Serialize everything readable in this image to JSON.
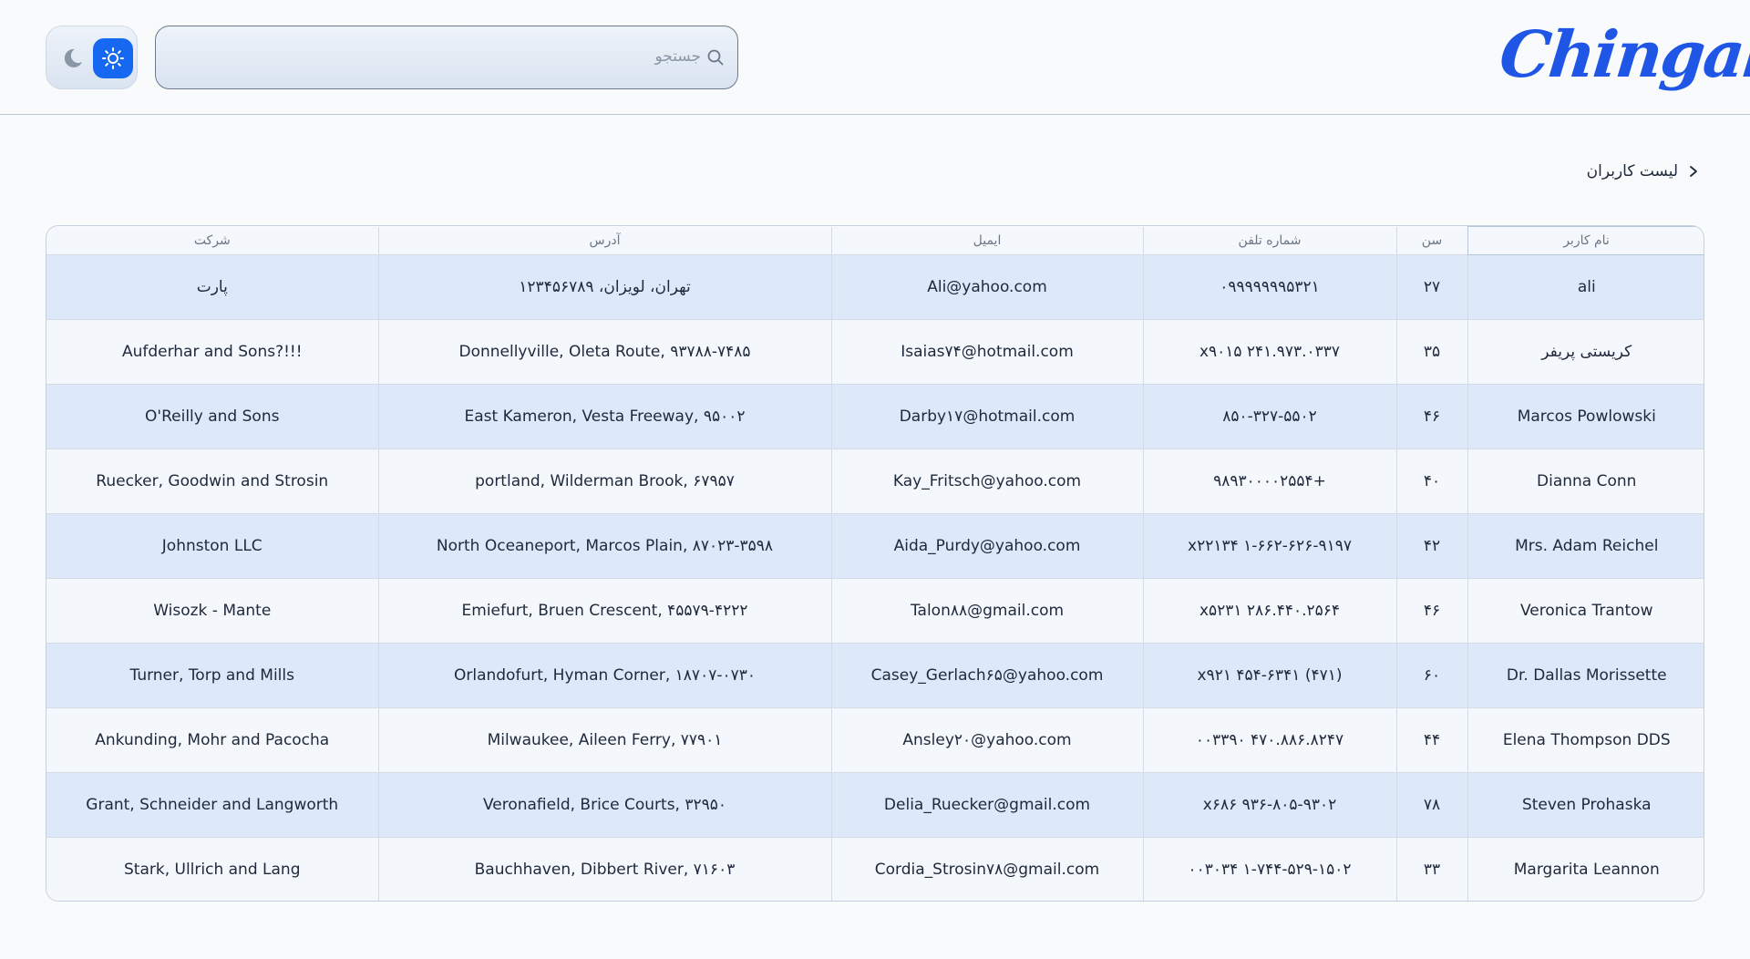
{
  "header": {
    "logo_text": "Chingal",
    "search_placeholder": "جستجو"
  },
  "theme": {
    "light_icon": "sun-icon",
    "dark_icon": "moon-icon",
    "active": "light",
    "accent": "#1668f0"
  },
  "breadcrumb": {
    "label": "لیست کاربران"
  },
  "table": {
    "columns": [
      "نام کاربر",
      "سن",
      "شماره تلفن",
      "ایمیل",
      "آدرس",
      "شرکت"
    ],
    "rows": [
      [
        "ali",
        "۲۷",
        "۰۹۹۹۹۹۹۹۵۳۲۱",
        "Ali@yahoo.com",
        "تهران، لویزان، ۱۲۳۴۵۶۷۸۹",
        "پارت"
      ],
      [
        "کریستی پریفر",
        "۳۵",
        "x۹۰۱۵ ۲۴۱.۹۷۳.۰۳۳۷",
        "Isaias۷۴@hotmail.com",
        "Donnellyville, Oleta Route, ۹۳۷۸۸-۷۴۸۵",
        "Aufderhar and Sons?!!!"
      ],
      [
        "Marcos Powlowski",
        "۴۶",
        "۸۵۰-۳۲۷-۵۵۰۲",
        "Darby۱۷@hotmail.com",
        "East Kameron, Vesta Freeway, ۹۵۰۰۲",
        "O'Reilly and Sons"
      ],
      [
        "Dianna Conn",
        "۴۰",
        "۹۸۹۳۰۰۰۰۲۵۵۴+",
        "Kay_Fritsch@yahoo.com",
        "portland, Wilderman Brook, ۶۷۹۵۷",
        "Ruecker, Goodwin and Strosin"
      ],
      [
        "Mrs. Adam Reichel",
        "۴۲",
        "x۲۲۱۳۴ ۱-۶۶۲-۶۲۶-۹۱۹۷",
        "Aida_Purdy@yahoo.com",
        "North Oceaneport, Marcos Plain, ۸۷۰۲۳-۳۵۹۸",
        "Johnston LLC"
      ],
      [
        "Veronica Trantow",
        "۴۶",
        "x۵۲۳۱ ۲۸۶.۴۴۰.۲۵۶۴",
        "Talon۸۸@gmail.com",
        "Emiefurt, Bruen Crescent, ۴۵۵۷۹-۴۲۲۲",
        "Wisozk - Mante"
      ],
      [
        "Dr. Dallas Morissette",
        "۶۰",
        "x۹۲۱ ۴۵۴-۶۳۴۱ (۴۷۱)",
        "Casey_Gerlach۶۵@yahoo.com",
        "Orlandofurt, Hyman Corner, ۱۸۷۰۷-۰۷۳۰",
        "Turner, Torp and Mills"
      ],
      [
        "Elena Thompson DDS",
        "۴۴",
        "۰۰۳۳۹۰ ۴۷۰.۸۸۶.۸۲۴۷",
        "Ansley۲۰@yahoo.com",
        "Milwaukee, Aileen Ferry, ۷۷۹۰۱",
        "Ankunding, Mohr and Pacocha"
      ],
      [
        "Steven Prohaska",
        "۷۸",
        "x۶۸۶ ۹۳۶-۸۰۵-۹۳۰۲",
        "Delia_Ruecker@gmail.com",
        "Veronafield, Brice Courts, ۳۲۹۵۰",
        "Grant, Schneider and Langworth"
      ],
      [
        "Margarita Leannon",
        "۳۳",
        "۰۰۳۰۳۴ ۱-۷۴۴-۵۲۹-۱۵۰۲",
        "Cordia_Strosin۷۸@gmail.com",
        "Bauchhaven, Dibbert River, ۷۱۶۰۳",
        "Stark, Ullrich and Lang"
      ]
    ]
  }
}
